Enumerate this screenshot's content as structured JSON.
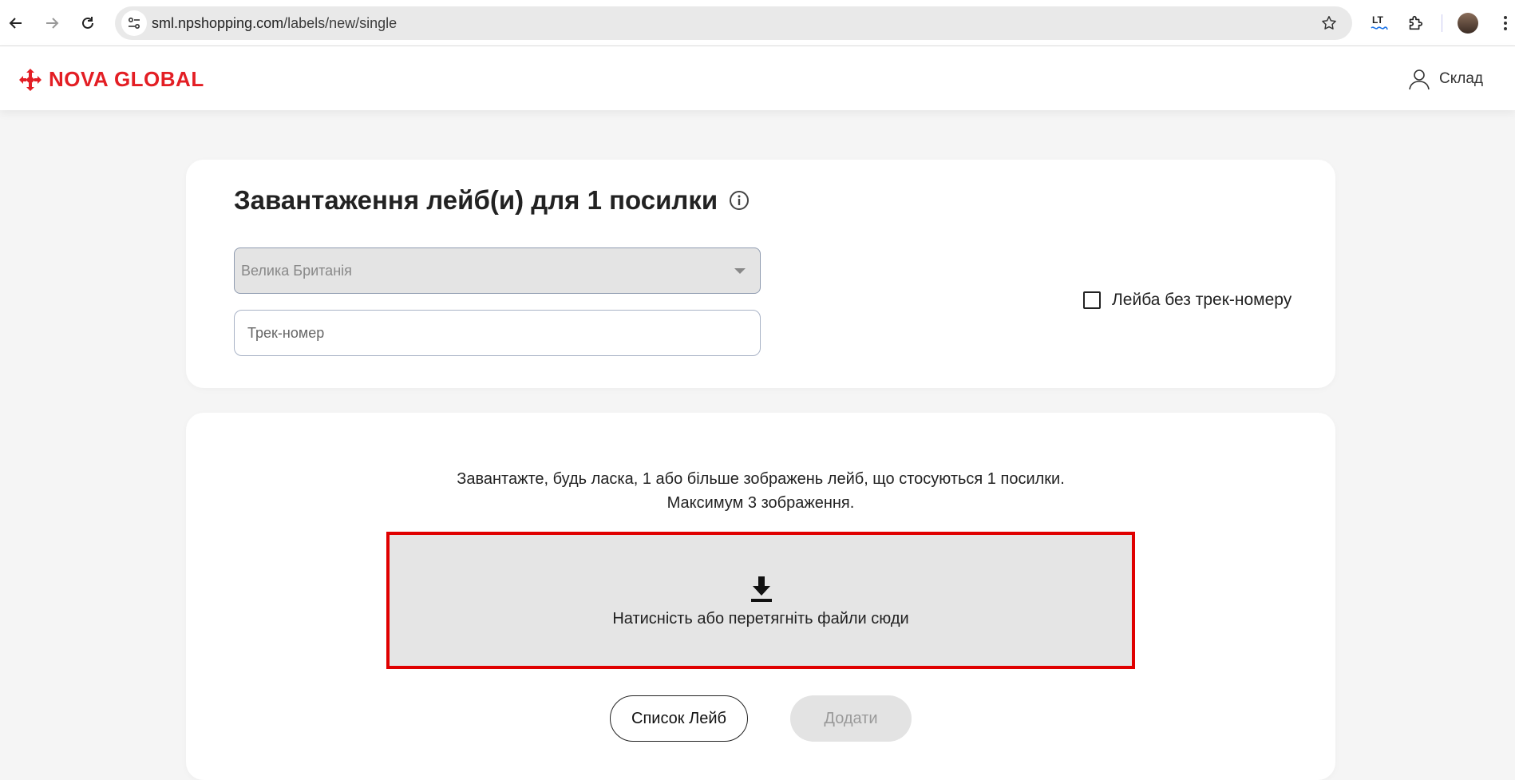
{
  "browser": {
    "url_host": "sml.npshopping.com",
    "url_path": "/labels/new/single",
    "icons": [
      "back-icon",
      "forward-icon",
      "reload-icon",
      "site-settings-icon",
      "bookmark-star-icon",
      "lt-extension-icon",
      "extensions-puzzle-icon",
      "profile-avatar",
      "menu-dots-icon"
    ],
    "lt_label": "LT"
  },
  "header": {
    "logo_text": "NOVA GLOBAL",
    "brand_color": "#e31e24",
    "user_label": "Склад"
  },
  "form": {
    "title": "Завантаження лейб(и) для 1 посилки",
    "country_value": "Велика Британія",
    "track_placeholder": "Трек-номер",
    "no_track_label": "Лейба без трек-номеру"
  },
  "upload": {
    "instruction_line1": "Завантажте, будь ласка, 1 або більше зображень лейб, що стосуються 1 посилки.",
    "instruction_line2": "Максимум 3 зображення.",
    "dropzone_text": "Натисність або перетягніть файли сюди",
    "list_button": "Список Лейб",
    "add_button": "Додати",
    "highlight_color": "#e00000"
  }
}
